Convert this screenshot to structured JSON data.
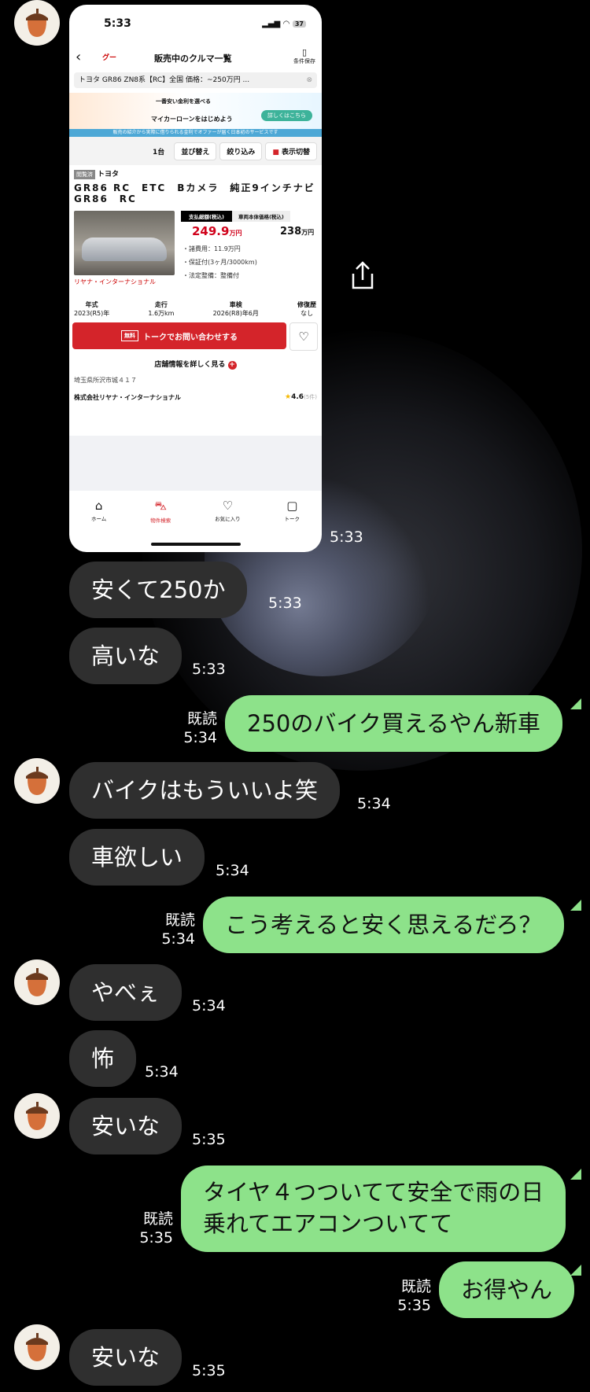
{
  "screenshot": {
    "status_time": "5:33",
    "battery": "37",
    "nav_title": "販売中のクルマ一覧",
    "logo": "グー",
    "save_label": "条件保存",
    "search_text": "トヨタ GR86 ZN8系【RC】全国 価格：~250万円 ...",
    "banner_line1": "一番安い金利を選べる",
    "banner_line2": "マイカーローンをはじめよう",
    "banner_button": "詳しくはこちら",
    "banner_strip": "販売の紹介から実際に借りられる金利でオファーが届く日本初のサービスです",
    "result_count": "1台",
    "sort_label": "並び替え",
    "filter_label": "絞り込み",
    "view_label": "表示切替",
    "viewed_badge": "閲覧済",
    "maker": "トヨタ",
    "car_name": "GR86 RC　ETC　Bカメラ　純正9インチナビ　GR86　RC",
    "tab_total": "支払総額(税込)",
    "tab_body": "車両本体価格(税込)",
    "total_price": "249.9",
    "body_price": "238",
    "price_unit": "万円",
    "fee": "・諸費用：11.9万円",
    "warranty": "・保証付(3ヶ月/3000km)",
    "maintenance": "・法定整備：整備付",
    "shop_name": "リヤナ・インターナショナル",
    "specs": [
      {
        "label": "年式",
        "value": "2023(R5)年"
      },
      {
        "label": "走行",
        "value": "1.6万km"
      },
      {
        "label": "車検",
        "value": "2026(R8)年6月"
      },
      {
        "label": "修復歴",
        "value": "なし"
      }
    ],
    "free_badge": "無料",
    "cta_label": "トークでお問い合わせする",
    "more_label": "店舗情報を詳しく見る",
    "address": "埼玉県所沢市城４１７",
    "dealer": "株式会社リヤナ・インターナショナル",
    "rating": "4.6",
    "rating_count": "(5件)",
    "tabbar": [
      "ホーム",
      "物件検索",
      "お気に入り",
      "トーク"
    ]
  },
  "screenshot_time": "5:33",
  "messages": [
    {
      "text": "安くて250か",
      "time": "5:33"
    },
    {
      "text": "高いな",
      "time": "5:33"
    },
    {
      "text": "250のバイク買えるやん新車",
      "read": "既読",
      "time": "5:34"
    },
    {
      "text": "バイクはもういいよ笑",
      "time": "5:34"
    },
    {
      "text": "車欲しい",
      "time": "5:34"
    },
    {
      "text": "こう考えると安く思えるだろ？",
      "read": "既読",
      "time": "5:34"
    },
    {
      "text": "やべぇ",
      "time": "5:34"
    },
    {
      "text": "怖",
      "time": "5:34"
    },
    {
      "text": "安いな",
      "time": "5:35"
    },
    {
      "line1": "タイヤ４つついてて安全で雨の日",
      "line2": "乗れてエアコンついてて",
      "read": "既読",
      "time": "5:35"
    },
    {
      "text": "お得やん",
      "read": "既読",
      "time": "5:35"
    },
    {
      "text": "安いな",
      "time": "5:35"
    }
  ]
}
